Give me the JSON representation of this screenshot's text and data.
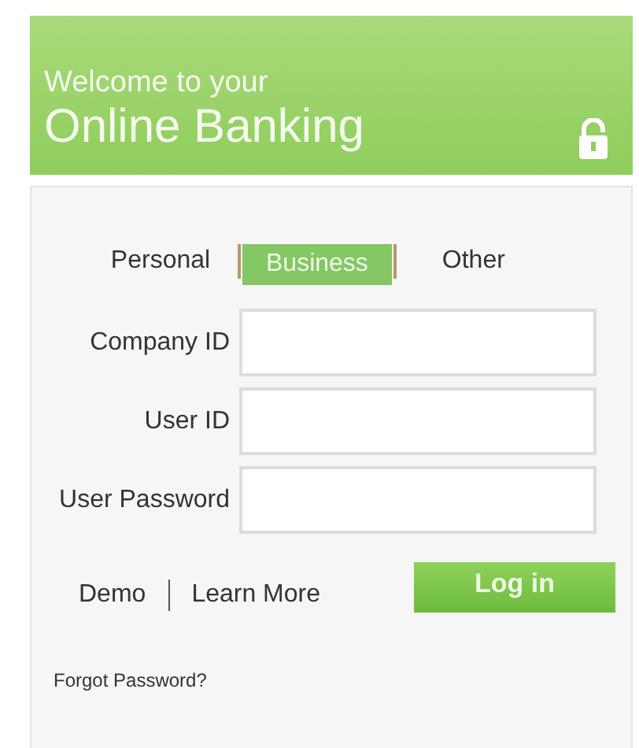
{
  "header": {
    "greeting": "Welcome to your",
    "title": "Online Banking"
  },
  "tabs": [
    {
      "label": "Personal",
      "selected": false
    },
    {
      "label": "Business",
      "selected": true
    },
    {
      "label": "Other",
      "selected": false
    }
  ],
  "fields": [
    {
      "label": "Company ID"
    },
    {
      "label": "User ID"
    },
    {
      "label": "User Password"
    }
  ],
  "links": [
    "Demo",
    "Learn More"
  ],
  "login_button": "Log in",
  "forgot_link": "Forgot Password?"
}
